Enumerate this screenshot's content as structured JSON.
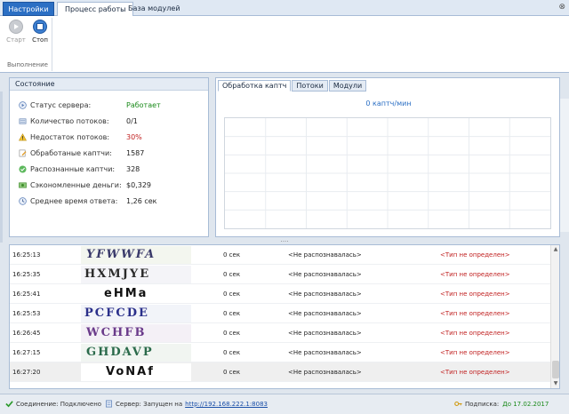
{
  "ribbon": {
    "settings_tab": "Настройки",
    "tabs": [
      {
        "label": "Процесс работы",
        "active": true
      },
      {
        "label": "База модулей",
        "active": false
      }
    ],
    "buttons": {
      "start": "Старт",
      "stop": "Стоп"
    },
    "group_caption": "Выполнение"
  },
  "state_panel": {
    "title": "Состояние",
    "rows": [
      {
        "label": "Статус сервера:",
        "value": "Работает",
        "icon": "server-status-icon",
        "tone": "green"
      },
      {
        "label": "Количество потоков:",
        "value": "0/1",
        "icon": "threads-icon",
        "tone": "normal"
      },
      {
        "label": "Недостаток потоков:",
        "value": "30%",
        "icon": "warning-icon",
        "tone": "red"
      },
      {
        "label": "Обработаные каптчи:",
        "value": "1587",
        "icon": "edit-icon",
        "tone": "normal"
      },
      {
        "label": "Распознанные каптчи:",
        "value": "328",
        "icon": "check-icon",
        "tone": "normal"
      },
      {
        "label": "Сэкономленные деньги:",
        "value": "$0,329",
        "icon": "money-icon",
        "tone": "normal"
      },
      {
        "label": "Среднее время ответа:",
        "value": "1,26 сек",
        "icon": "clock-icon",
        "tone": "normal"
      }
    ]
  },
  "chart_panel": {
    "tabs": [
      {
        "label": "Обработка каптч",
        "active": true
      },
      {
        "label": "Потоки",
        "active": false
      },
      {
        "label": "Модули",
        "active": false
      }
    ],
    "rate": "0 каптч/мин"
  },
  "log": {
    "rows": [
      {
        "time": "16:25:13",
        "captcha": "YFWWFA",
        "duration": "0 сек",
        "result": "<Не распознавалась>",
        "type": "<Тип не определен>"
      },
      {
        "time": "16:25:35",
        "captcha": "HXMJYE",
        "duration": "0 сек",
        "result": "<Не распознавалась>",
        "type": "<Тип не определен>"
      },
      {
        "time": "16:25:41",
        "captcha": "eHMa",
        "duration": "0 сек",
        "result": "<Не распознавалась>",
        "type": "<Тип не определен>"
      },
      {
        "time": "16:25:53",
        "captcha": "PCFCDE",
        "duration": "0 сек",
        "result": "<Не распознавалась>",
        "type": "<Тип не определен>"
      },
      {
        "time": "16:26:45",
        "captcha": "WCHFB",
        "duration": "0 сек",
        "result": "<Не распознавалась>",
        "type": "<Тип не определен>"
      },
      {
        "time": "16:27:15",
        "captcha": "GHDAVP",
        "duration": "0 сек",
        "result": "<Не распознавалась>",
        "type": "<Тип не определен>"
      },
      {
        "time": "16:27:20",
        "captcha": "VoNAf",
        "duration": "0 сек",
        "result": "<Не распознавалась>",
        "type": "<Тип не определен>"
      }
    ]
  },
  "statusbar": {
    "connection": "Соединение: Подключено",
    "server_prefix": "Сервер: Запущен на",
    "server_url": "http://192.168.222.1:8083",
    "subscription_label": "Подписка:",
    "subscription_value": "До 17.02.2017"
  }
}
